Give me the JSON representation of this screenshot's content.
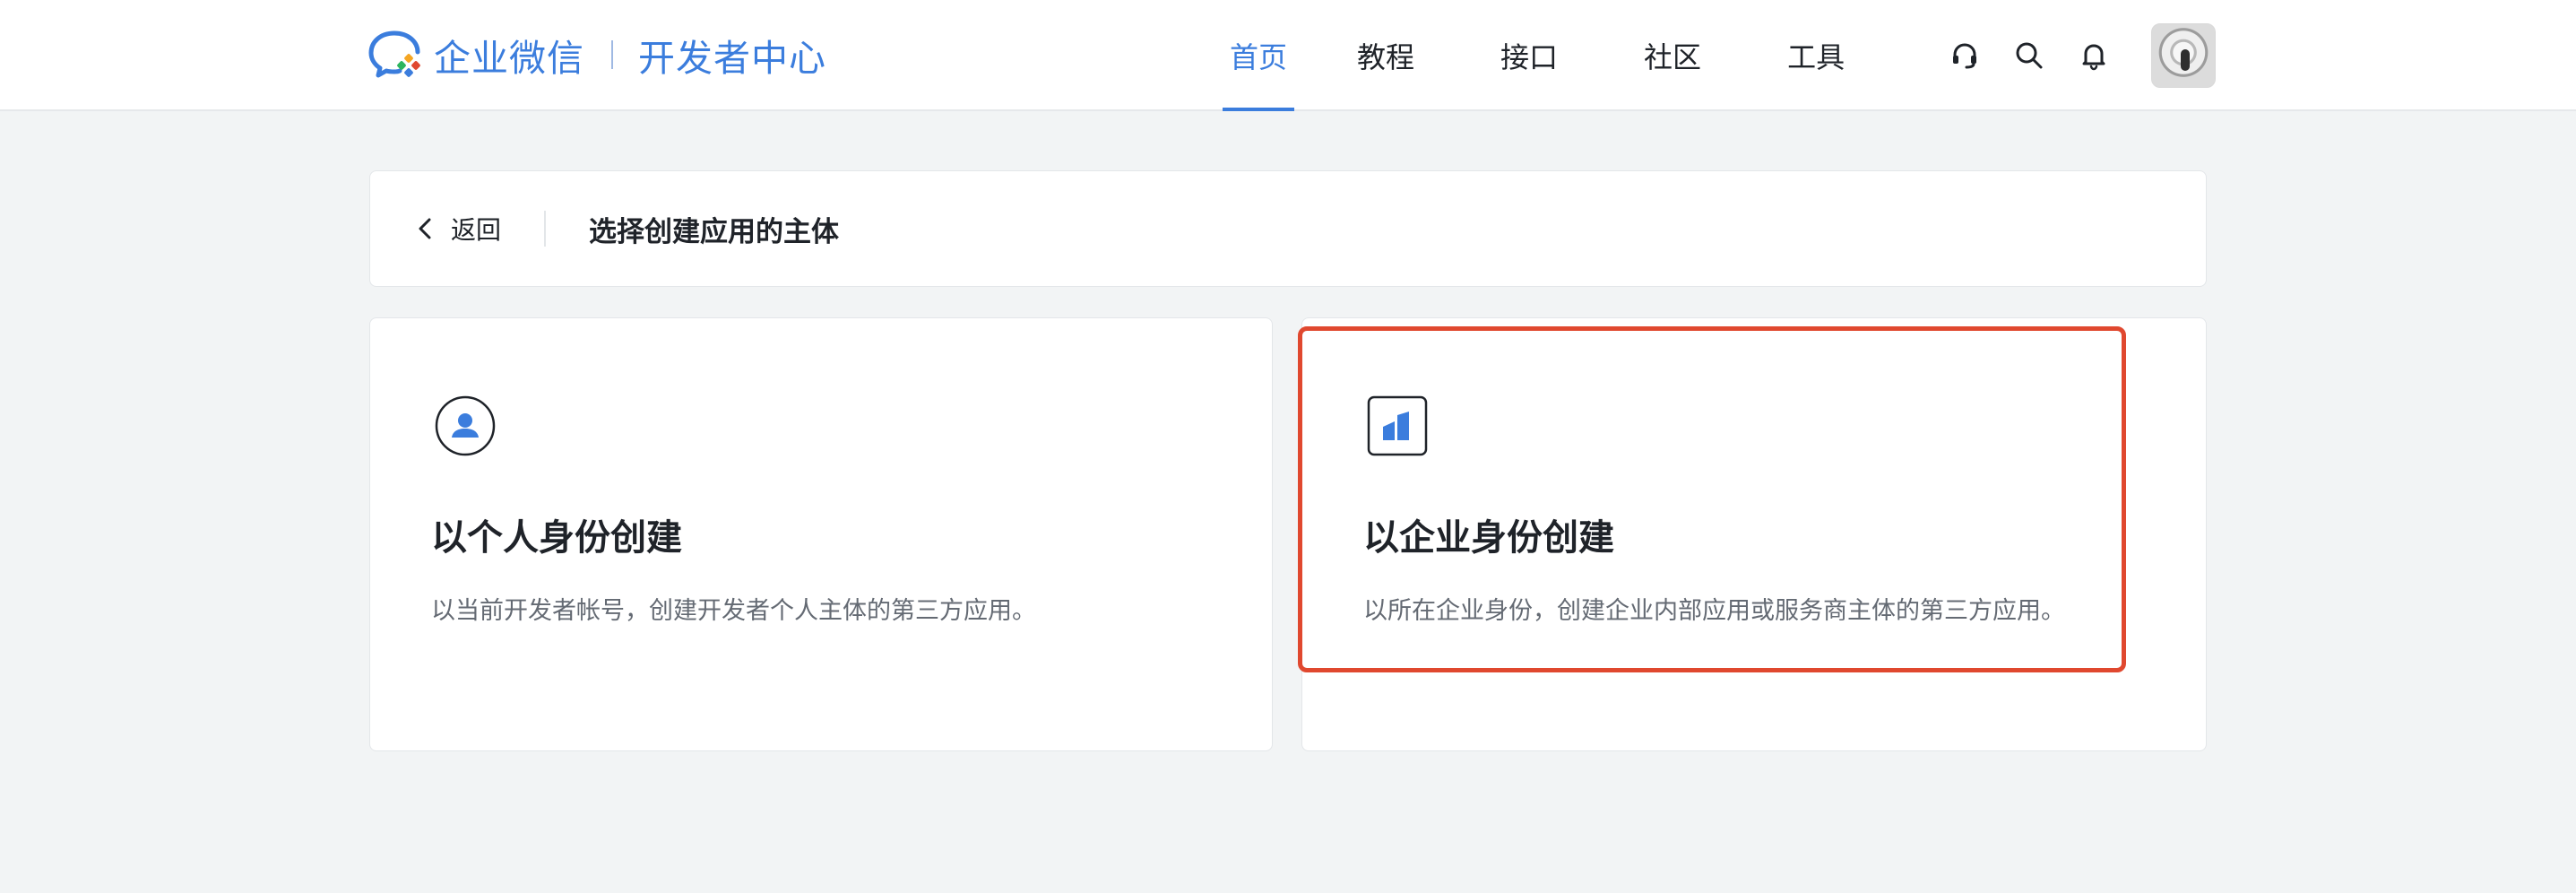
{
  "brand": {
    "name": "企业微信",
    "subtitle": "开发者中心"
  },
  "nav": {
    "items": [
      {
        "label": "首页",
        "active": true
      },
      {
        "label": "教程",
        "active": false
      },
      {
        "label": "接口",
        "active": false
      },
      {
        "label": "社区",
        "active": false
      },
      {
        "label": "工具",
        "active": false
      }
    ]
  },
  "toolbar": {
    "icons": [
      "headset-icon",
      "search-icon",
      "bell-icon",
      "avatar"
    ]
  },
  "header": {
    "back_label": "返回",
    "title": "选择创建应用的主体"
  },
  "options": [
    {
      "icon": "person-icon",
      "title": "以个人身份创建",
      "description": "以当前开发者帐号，创建开发者个人主体的第三方应用。"
    },
    {
      "icon": "building-icon",
      "title": "以企业身份创建",
      "description": "以所在企业身份，创建企业内部应用或服务商主体的第三方应用。",
      "highlighted": true
    }
  ],
  "colors": {
    "accent": "#3b7ddd",
    "highlight": "#e0482f",
    "background": "#f2f4f5"
  }
}
